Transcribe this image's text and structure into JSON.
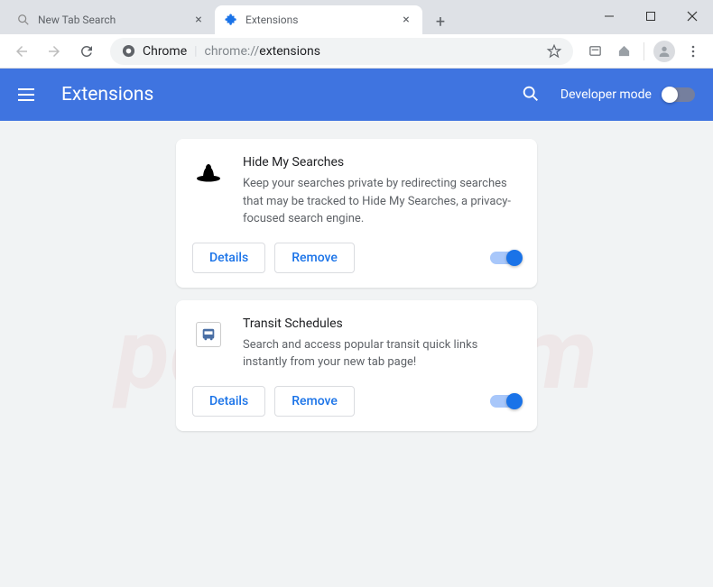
{
  "window": {
    "tabs": [
      {
        "title": "New Tab Search",
        "active": false
      },
      {
        "title": "Extensions",
        "active": true
      }
    ]
  },
  "address": {
    "prefix": "Chrome",
    "url_gray": "chrome://",
    "url_dark": "extensions"
  },
  "header": {
    "title": "Extensions",
    "dev_mode_label": "Developer mode"
  },
  "extensions": [
    {
      "name": "Hide My Searches",
      "description": "Keep your searches private by redirecting searches that may be tracked to Hide My Searches, a privacy-focused search engine.",
      "details_label": "Details",
      "remove_label": "Remove",
      "enabled": true,
      "icon": "hat"
    },
    {
      "name": "Transit Schedules",
      "description": "Search and access popular transit quick links instantly from your new tab page!",
      "details_label": "Details",
      "remove_label": "Remove",
      "enabled": true,
      "icon": "bus"
    }
  ],
  "watermark": "pcrisk.com"
}
